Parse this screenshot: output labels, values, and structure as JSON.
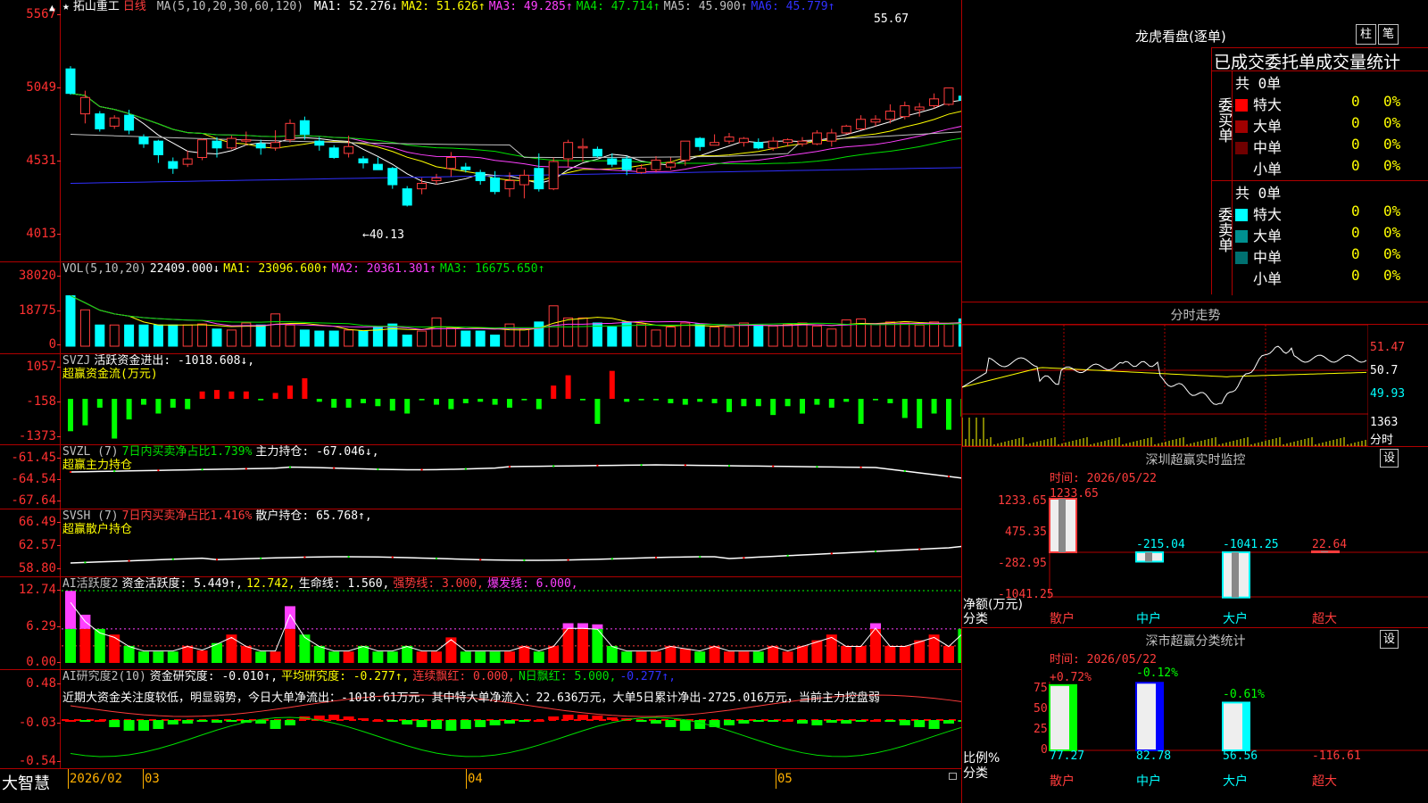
{
  "stock": {
    "star": "★",
    "name": "拓山重工",
    "period": "日线"
  },
  "kline": {
    "ma_label": "MA(5,10,20,30,60,120)",
    "ma": [
      {
        "t": "MA1: 52.276↓",
        "c": "#ffffff"
      },
      {
        "t": "MA2: 51.626↑",
        "c": "#ffff00"
      },
      {
        "t": "MA3: 49.285↑",
        "c": "#ff40ff"
      },
      {
        "t": "MA4: 47.714↑",
        "c": "#00e000"
      },
      {
        "t": "MA5: 45.900↑",
        "c": "#c0c0c0"
      },
      {
        "t": "MA6: 45.779↑",
        "c": "#3030ff"
      }
    ],
    "yticks": [
      "5567",
      "5049",
      "4531",
      "4013"
    ],
    "hi_label": "55.67",
    "lo_label": "←40.13",
    "candles": [
      [
        52.8,
        51.0,
        53.0,
        50.9
      ],
      [
        49.5,
        50.7,
        51.2,
        48.8
      ],
      [
        49.5,
        48.4,
        49.7,
        48.2
      ],
      [
        48.6,
        49.2,
        49.4,
        48.4
      ],
      [
        49.4,
        48.3,
        49.8,
        48.0
      ],
      [
        47.8,
        47.3,
        48.0,
        47.0
      ],
      [
        47.5,
        46.5,
        47.6,
        45.9
      ],
      [
        46.0,
        45.5,
        46.3,
        45.1
      ],
      [
        45.8,
        46.2,
        46.8,
        45.6
      ],
      [
        46.3,
        47.6,
        47.7,
        46.1
      ],
      [
        47.5,
        47.0,
        47.8,
        46.3
      ],
      [
        47.0,
        47.7,
        47.9,
        46.9
      ],
      [
        47.5,
        47.6,
        48.2,
        47.2
      ],
      [
        47.3,
        47.0,
        47.6,
        46.5
      ],
      [
        47.0,
        47.4,
        48.3,
        46.8
      ],
      [
        47.6,
        48.8,
        49.1,
        47.4
      ],
      [
        49.0,
        48.0,
        49.3,
        47.6
      ],
      [
        47.5,
        47.2,
        47.8,
        46.8
      ],
      [
        47.0,
        46.3,
        47.2,
        46.2
      ],
      [
        46.6,
        47.1,
        47.9,
        46.3
      ],
      [
        46.2,
        45.9,
        46.4,
        45.5
      ],
      [
        45.8,
        45.4,
        46.3,
        45.4
      ],
      [
        45.5,
        44.3,
        45.6,
        44.0
      ],
      [
        44.0,
        42.8,
        44.2,
        42.7
      ],
      [
        44.0,
        44.4,
        44.8,
        43.6
      ],
      [
        44.6,
        44.8,
        45.1,
        44.3
      ],
      [
        45.5,
        46.3,
        46.7,
        44.9
      ],
      [
        45.6,
        45.4,
        45.9,
        45.2
      ],
      [
        45.2,
        44.6,
        45.4,
        44.3
      ],
      [
        44.8,
        43.8,
        45.3,
        43.6
      ],
      [
        44.0,
        44.6,
        45.2,
        43.4
      ],
      [
        44.3,
        45.0,
        45.4,
        43.3
      ],
      [
        45.5,
        44.0,
        46.6,
        43.8
      ],
      [
        44.0,
        46.0,
        46.3,
        43.9
      ],
      [
        46.2,
        47.4,
        47.6,
        45.6
      ],
      [
        47.0,
        47.1,
        47.7,
        46.0
      ],
      [
        46.9,
        46.4,
        47.1,
        46.3
      ],
      [
        46.2,
        45.8,
        46.6,
        45.6
      ],
      [
        46.2,
        45.4,
        46.4,
        45.0
      ],
      [
        45.2,
        45.5,
        45.8,
        45.1
      ],
      [
        45.4,
        46.1,
        46.4,
        45.2
      ],
      [
        45.6,
        45.9,
        46.3,
        45.4
      ],
      [
        46.1,
        47.5,
        47.5,
        45.7
      ],
      [
        47.7,
        47.1,
        47.8,
        46.8
      ],
      [
        47.2,
        47.4,
        48.0,
        47.2
      ],
      [
        47.5,
        47.8,
        48.1,
        47.3
      ],
      [
        47.4,
        47.7,
        47.8,
        47.1
      ],
      [
        47.4,
        47.0,
        47.7,
        46.9
      ],
      [
        47.0,
        47.5,
        47.8,
        46.8
      ],
      [
        47.4,
        47.6,
        47.7,
        47.1
      ],
      [
        47.3,
        47.5,
        47.8,
        47.1
      ],
      [
        47.3,
        48.1,
        48.3,
        47.2
      ],
      [
        47.5,
        48.1,
        48.4,
        47.1
      ],
      [
        48.1,
        48.6,
        48.7,
        48.0
      ],
      [
        48.4,
        49.1,
        49.4,
        48.3
      ],
      [
        48.9,
        49.1,
        49.4,
        48.6
      ],
      [
        49.1,
        49.7,
        50.2,
        48.8
      ],
      [
        49.3,
        50.1,
        50.4,
        49.1
      ],
      [
        49.8,
        50.0,
        50.3,
        49.3
      ],
      [
        50.1,
        50.6,
        51.0,
        49.9
      ],
      [
        50.2,
        51.4,
        51.4,
        50.1
      ],
      [
        50.8,
        50.5,
        51.3,
        50.3
      ],
      [
        51.3,
        52.3,
        52.4,
        51.0
      ],
      [
        51.6,
        52.8,
        53.7,
        51.6
      ],
      [
        52.5,
        53.5,
        54.1,
        52.3
      ],
      [
        52.9,
        54.0,
        54.5,
        52.6
      ],
      [
        54.1,
        55.1,
        55.4,
        53.8
      ],
      [
        55.3,
        54.4,
        55.6,
        54.1
      ],
      [
        53.9,
        53.2,
        54.1,
        52.6
      ],
      [
        53.2,
        53.1,
        53.5,
        51.4
      ]
    ]
  },
  "vol": {
    "label": "VOL(5,10,20)",
    "v": "22409.000↓",
    "ma1": "MA1: 23096.600↑",
    "ma2": "MA2: 20361.301↑",
    "ma3": "MA3: 16675.650↑",
    "yticks": [
      "38020",
      "18775",
      "0"
    ],
    "values": [
      25000,
      18000,
      10500,
      10500,
      10500,
      10500,
      10500,
      10500,
      10500,
      11000,
      8500,
      8000,
      11500,
      10500,
      16000,
      10500,
      8000,
      7500,
      7500,
      8000,
      7500,
      9500,
      11000,
      5500,
      7500,
      14000,
      9000,
      7500,
      7500,
      5500,
      11000,
      8500,
      12000,
      20000,
      14000,
      14000,
      11500,
      9500,
      12000,
      11000,
      8000,
      9500,
      11500,
      11000,
      9500,
      9500,
      11500,
      10500,
      10000,
      11000,
      11500,
      10000,
      8500,
      13000,
      13500,
      11000,
      12000,
      11500,
      10500,
      12000,
      11000,
      13500,
      10500,
      14500,
      11000,
      12000,
      14500,
      24500,
      21500,
      15500
    ]
  },
  "svzj": {
    "l1": "SVZJ",
    "l2": "活跃资金进出: -1018.608↓,",
    "l3": "超赢资金流(万元)",
    "yticks": [
      "1057",
      "-158",
      "-1373"
    ],
    "values": [
      -1100,
      -900,
      -300,
      -1350,
      -700,
      -200,
      -500,
      -300,
      -350,
      250,
      300,
      250,
      250,
      -50,
      200,
      450,
      700,
      -100,
      -300,
      -300,
      -150,
      -250,
      -400,
      -500,
      -50,
      -200,
      -350,
      -150,
      -100,
      -200,
      -300,
      -50,
      -350,
      450,
      800,
      -50,
      -850,
      950,
      -100,
      -50,
      -50,
      -150,
      -200,
      -100,
      -150,
      -450,
      -250,
      -250,
      -550,
      -250,
      -500,
      -200,
      -300,
      -100,
      -850,
      -50,
      -150,
      -650,
      -1000,
      -500,
      -1050,
      -600,
      -150,
      -200,
      -250,
      250,
      250,
      -700,
      -900,
      -1100
    ]
  },
  "svzl": {
    "l1": "SVZL (7)",
    "l2": "7日内买卖净占比1.739%",
    "l3": "主力持仓: -67.046↓,",
    "l4": "超赢主力持仓",
    "yticks": [
      "-61.45",
      "-64.54",
      "-67.64"
    ]
  },
  "svsh": {
    "l1": "SVSH (7)",
    "l2": "7日内买卖净占比1.416%",
    "l3": "散户持仓: 65.768↑,",
    "l4": "超赢散户持仓",
    "yticks": [
      "66.49",
      "62.57",
      "58.80"
    ]
  },
  "ai2": {
    "l1": "AI活跃度2",
    "l2": "资金活跃度: 5.449↑,",
    "l3": "12.742,",
    "l4": "生命线: 1.560,",
    "l5": "强势线: 3.000,",
    "l6": "爆发线: 6.000,",
    "yticks": [
      "12.74",
      "6.29",
      "0.00"
    ]
  },
  "ai_res": {
    "l1": "AI研究度2(10)",
    "l2": "资金研究度: -0.010↑,",
    "l3": "平均研究度: -0.277↑,",
    "l4": "连续飘红: 0.000,",
    "l5": "N日飘红: 5.000,",
    "l6": "-0.277↑,",
    "yticks": [
      "0.48",
      "-0.03",
      "-0.54"
    ],
    "comment": "近期大资金关注度较低，明显弱势，今日大单净流出：-1018.61万元，其中特大单净流入：22.636万元，大单5日累计净出-2725.016万元，当前主力控盘弱"
  },
  "bottom": {
    "brand": "大智慧",
    "dates": [
      "2026/02",
      "03",
      "04",
      "05"
    ]
  },
  "right": {
    "lhb_title": "龙虎看盘(逐单)",
    "btn1": "柱",
    "btn2": "笔",
    "order_title": "已成交委托单成交量统计",
    "buy_label": "委买单",
    "sell_label": "委卖单",
    "buy_total": "共 0单",
    "sell_total": "共 0单",
    "buy_rows": [
      {
        "n": "特大",
        "c": "#ff0000",
        "v": "0",
        "p": "0%"
      },
      {
        "n": "大单",
        "c": "#a00000",
        "v": "0",
        "p": "0%"
      },
      {
        "n": "中单",
        "c": "#700000",
        "v": "0",
        "p": "0%"
      },
      {
        "n": "小单",
        "c": "#000000",
        "v": "0",
        "p": "0%"
      }
    ],
    "sell_rows": [
      {
        "n": "特大",
        "c": "#00ffff",
        "v": "0",
        "p": "0%"
      },
      {
        "n": "大单",
        "c": "#009090",
        "v": "0",
        "p": "0%"
      },
      {
        "n": "中单",
        "c": "#007070",
        "v": "0",
        "p": "0%"
      },
      {
        "n": "小单",
        "c": "#000000",
        "v": "0",
        "p": "0%"
      }
    ],
    "fs_title": "分时走势",
    "fs_y": [
      "51.47",
      "50.7",
      "49.93"
    ],
    "fs_vol": "1363",
    "fs_vollab": "分时",
    "mon_title": "深圳超赢实时监控",
    "mon_set": "设",
    "mon_time": "时间: 2026/05/22",
    "mon_y": [
      "1233.65",
      "475.35",
      "-282.95",
      "-1041.25"
    ],
    "mon_vals": [
      {
        "v": "1233.65",
        "c": "#ff3c3c"
      },
      {
        "v": "-215.04",
        "c": "#00ffff"
      },
      {
        "v": "-1041.25",
        "c": "#00ffff"
      },
      {
        "v": "22.64",
        "c": "#ff3c3c"
      }
    ],
    "mon_unit": "净额(万元)",
    "mon_cat": "分类",
    "cats": [
      "散户",
      "中户",
      "大户",
      "超大"
    ],
    "cls_title": "深市超赢分类统计",
    "cls_set": "设",
    "cls_time": "时间: 2026/05/22",
    "cls_y": [
      "75",
      "50",
      "25",
      "0"
    ],
    "cls_top": [
      {
        "v": "+0.72%",
        "c": "#ff3c3c"
      },
      {
        "v": "-0.12%",
        "c": "#00ff00"
      },
      {
        "v": "-0.61%",
        "c": "#00ff00"
      }
    ],
    "cls_bottom": [
      {
        "v": "77.27",
        "c": "#00ffff"
      },
      {
        "v": "82.78",
        "c": "#00ffff"
      },
      {
        "v": "56.56",
        "c": "#00ffff"
      },
      {
        "v": "-116.61",
        "c": "#ff3c3c"
      }
    ],
    "cls_pct": [
      77.27,
      82.78,
      56.56
    ],
    "cls_unit": "比例%",
    "cls_cat": "分类"
  }
}
